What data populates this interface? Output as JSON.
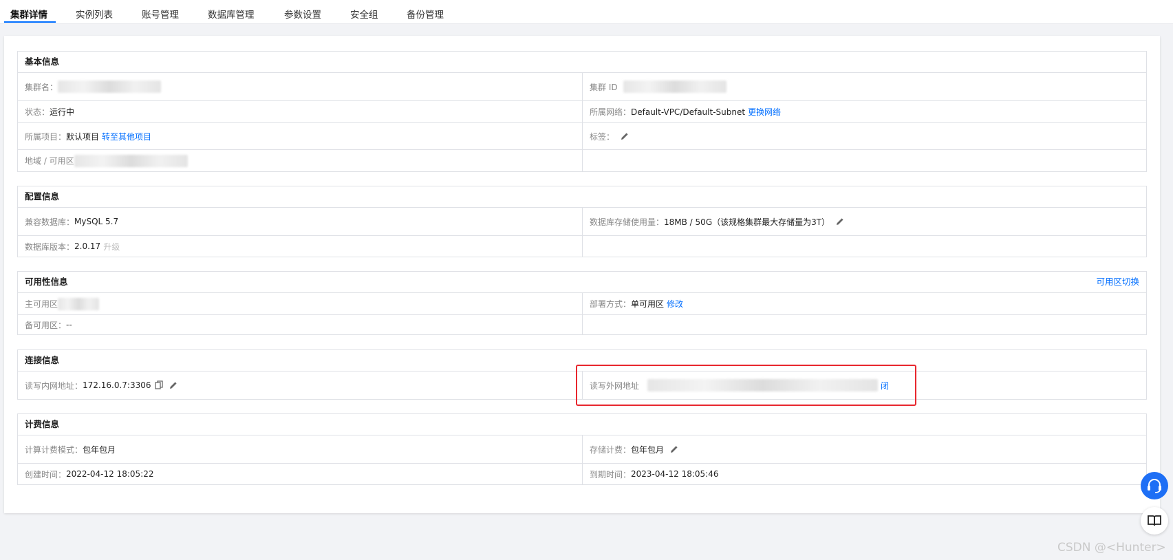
{
  "tabs": [
    "集群详情",
    "实例列表",
    "账号管理",
    "数据库管理",
    "参数设置",
    "安全组",
    "备份管理"
  ],
  "basic": {
    "title": "基本信息",
    "cluster_name_label": "集群名：",
    "cluster_id_label": "集群 ID",
    "status_label": "状态：",
    "status_value": "运行中",
    "network_label": "所属网络：",
    "network_value": "Default-VPC/Default-Subnet",
    "network_link": "更换网络",
    "project_label": "所属项目：",
    "project_value": "默认项目",
    "project_link": "转至其他项目",
    "tag_label": "标签：",
    "region_label": "地域 / 可用区"
  },
  "config": {
    "title": "配置信息",
    "db_label": "兼容数据库：",
    "db_value": "MySQL 5.7",
    "storage_label": "数据库存储使用量：",
    "storage_value": "18MB / 50G（该规格集群最大存储量为3T）",
    "version_label": "数据库版本：",
    "version_value": "2.0.17",
    "upgrade_label": "升级"
  },
  "avail": {
    "title": "可用性信息",
    "switch_link": "可用区切换",
    "primary_label": "主可用区",
    "deploy_label": "部署方式：",
    "deploy_value": "单可用区",
    "modify_link": "修改",
    "backup_label": "备可用区：",
    "backup_value": "--"
  },
  "conn": {
    "title": "连接信息",
    "inner_label": "读写内网地址：",
    "inner_value": "172.16.0.7:3306",
    "outer_label": "读写外网地址",
    "outer_link": "闭"
  },
  "billing": {
    "title": "计费信息",
    "compute_label": "计算计费模式：",
    "compute_value": "包年包月",
    "storage_label": "存储计费：",
    "storage_value": "包年包月",
    "created_label": "创建时间：",
    "created_value": "2022-04-12 18:05:22",
    "expire_label": "到期时间：",
    "expire_value": "2023-04-12 18:05:46"
  },
  "watermark": "CSDN @<Hunter>",
  "colors": {
    "accent": "#006eff",
    "highlight": "#e8272e"
  }
}
